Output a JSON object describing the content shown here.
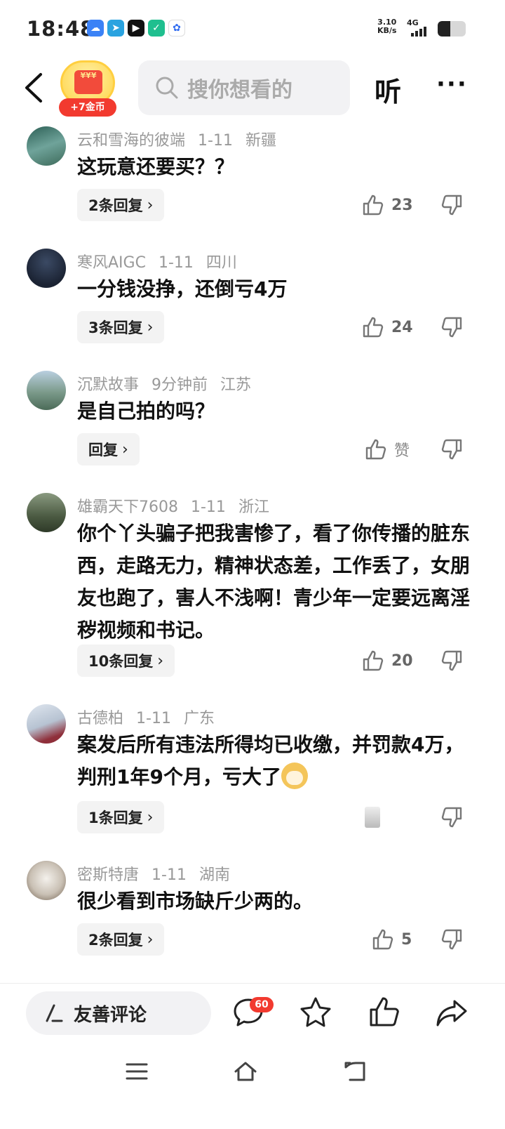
{
  "status_bar": {
    "time": "18:48",
    "net_speed_value": "3.10",
    "net_speed_unit": "KB/s",
    "network": "4G",
    "battery_level": 0.45,
    "app_icons": [
      "cloud-app-icon",
      "telegram-icon",
      "video-app-icon",
      "shield-app-icon",
      "baidu-app-icon"
    ]
  },
  "header": {
    "coin_label": "+7金币",
    "coin_env_text": "¥¥¥",
    "search_placeholder": "搜你想看的",
    "listen_label": "听",
    "more_label": "···"
  },
  "comments": [
    {
      "user": "云和雪海的彼端",
      "date": "1-11",
      "location": "新疆",
      "text": "这玩意还要买？？",
      "reply_label": "2条回复",
      "likes": "23"
    },
    {
      "user": "寒风AIGC",
      "date": "1-11",
      "location": "四川",
      "text": "一分钱没挣，还倒亏4万",
      "reply_label": "3条回复",
      "likes": "24"
    },
    {
      "user": "沉默故事",
      "date": "9分钟前",
      "location": "江苏",
      "text": "是自己拍的吗？",
      "reply_label": "回复",
      "likes": "赞"
    },
    {
      "user": "雄霸天下7608",
      "date": "1-11",
      "location": "浙江",
      "text": "你个丫头骗子把我害惨了，看了你传播的脏东西，走路无力，精神状态差，工作丢了，女朋友也跑了，害人不浅啊！青少年一定要远离淫秽视频和书记。",
      "reply_label": "10条回复",
      "likes": "20"
    },
    {
      "user": "古德柏",
      "date": "1-11",
      "location": "广东",
      "text": "案发后所有违法所得均已收缴，并罚款4万，判刑1年9个月，亏大了",
      "reply_label": "1条回复",
      "likes": ""
    },
    {
      "user": "密斯特唐",
      "date": "1-11",
      "location": "湖南",
      "text": "很少看到市场缺斤少两的。",
      "reply_label": "2条回复",
      "likes": "5"
    }
  ],
  "bottom_bar": {
    "comment_placeholder": "友善评论",
    "comment_count_badge": "60"
  },
  "colors": {
    "accent_red": "#f23a2f",
    "coin_gold": "#ffd44a",
    "meta_gray": "#999999"
  }
}
